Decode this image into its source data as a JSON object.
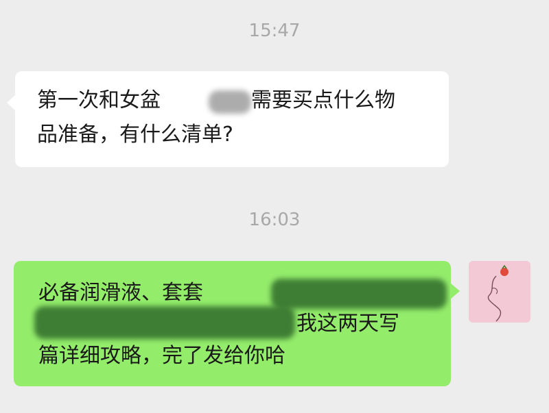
{
  "chat": {
    "timestamp_1": "15:47",
    "timestamp_2": "16:03",
    "msg1": {
      "line1_a": "第一次和女盆",
      "line1_b": "需要买点什么物",
      "line2": "品准备，有什么清单?"
    },
    "msg2": {
      "line1": "必备润滑液、套套",
      "line2": "我这两天写",
      "line3": "篇详细攻略，完了发给你哈"
    }
  },
  "colors": {
    "background": "#ededed",
    "incoming_bubble": "#ffffff",
    "outgoing_bubble": "#94ec6b",
    "timestamp_text": "#a8a8a8",
    "avatar_bg": "#f2c9d4"
  },
  "icons": {
    "avatar": "user-avatar-icon"
  }
}
